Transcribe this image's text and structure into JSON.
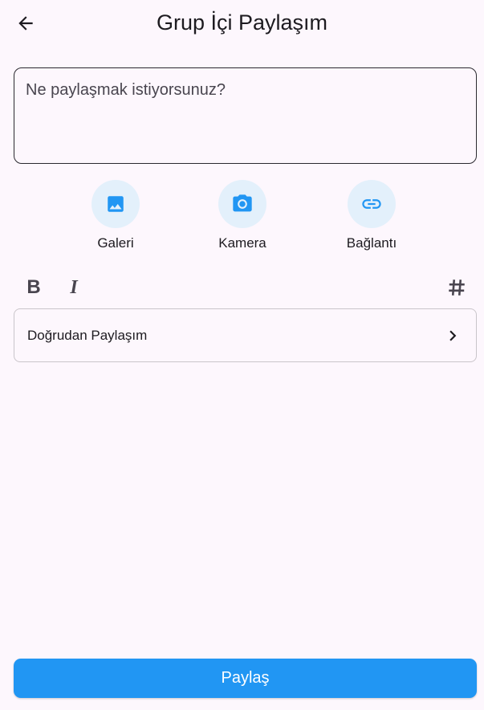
{
  "app_bar": {
    "title": "Grup İçi Paylaşım",
    "back_icon": "arrow-back-icon"
  },
  "composer": {
    "placeholder": "Ne paylaşmak istiyorsunuz?",
    "value": ""
  },
  "media_actions": [
    {
      "label": "Galeri",
      "icon": "image-icon"
    },
    {
      "label": "Kamera",
      "icon": "camera-icon"
    },
    {
      "label": "Bağlantı",
      "icon": "link-icon"
    }
  ],
  "formatting": {
    "bold_label": "B",
    "italic_label": "I",
    "hashtag_icon": "hashtag-icon"
  },
  "direct_share": {
    "label": "Doğrudan Paylaşım",
    "icon": "chevron-right-icon"
  },
  "submit": {
    "label": "Paylaş"
  },
  "colors": {
    "accent": "#2196f3",
    "icon_circle_bg": "#e3f0fb",
    "background": "#fdf7fd"
  }
}
